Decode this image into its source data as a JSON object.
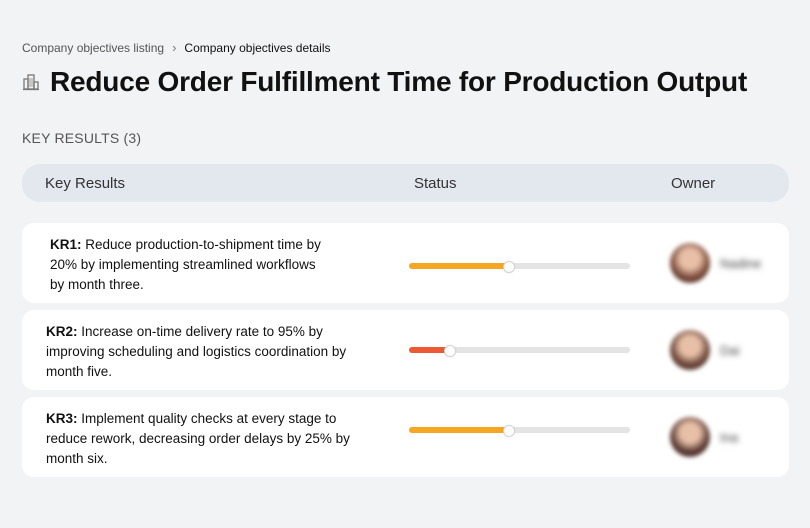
{
  "breadcrumb": {
    "parent": "Company objectives listing",
    "separator": "›",
    "current": "Company objectives details"
  },
  "title": {
    "icon": "building-icon",
    "text": "Reduce Order Fulfillment Time for Production Output"
  },
  "section_label": "KEY RESULTS (3)",
  "table": {
    "columns": [
      "Key Results",
      "Status",
      "Owner"
    ],
    "rows": [
      {
        "id": "KR1:",
        "text": "Reduce production-to-shipment time by 20% by implementing streamlined workflows by month three.",
        "progress": 0.45,
        "progress_color": "#f5a623",
        "owner": "Nadine",
        "avatar_color": "#7a4a3a"
      },
      {
        "id": "KR2:",
        "text": "Increase on-time delivery rate to 95% by improving scheduling and logistics coordination by month five.",
        "progress": 0.18,
        "progress_color": "#ec5a34",
        "owner": "Dai",
        "avatar_color": "#6b4638"
      },
      {
        "id": "KR3:",
        "text": "Implement quality checks at every stage to reduce rework, decreasing order delays by 25% by month six.",
        "progress": 0.45,
        "progress_color": "#f5a623",
        "owner": "Ina",
        "avatar_color": "#5a3a32"
      }
    ]
  }
}
